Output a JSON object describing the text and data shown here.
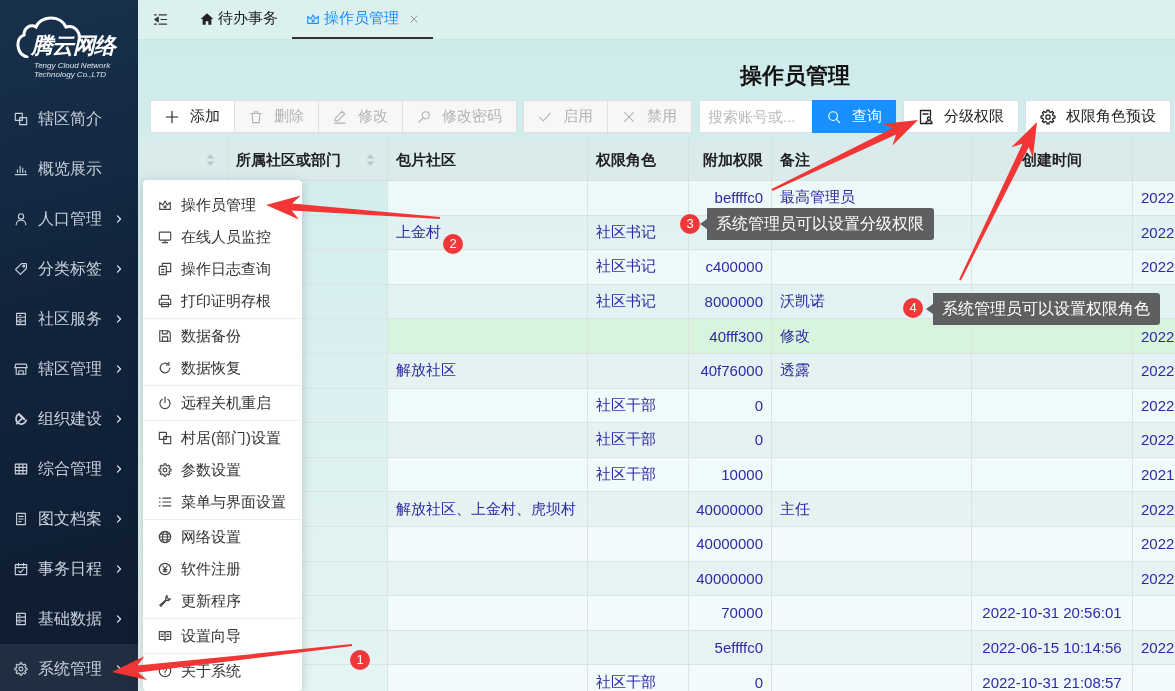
{
  "sidebar": {
    "logo": {
      "name": "腾云网络",
      "tagline": "Tengy Cloud Network Technology Co.,LTD"
    },
    "items": [
      {
        "label": "辖区简介",
        "expandable": false,
        "selected": false
      },
      {
        "label": "概览展示",
        "expandable": false,
        "selected": false
      },
      {
        "label": "人口管理",
        "expandable": true,
        "selected": false
      },
      {
        "label": "分类标签",
        "expandable": true,
        "selected": false
      },
      {
        "label": "社区服务",
        "expandable": true,
        "selected": false
      },
      {
        "label": "辖区管理",
        "expandable": true,
        "selected": false
      },
      {
        "label": "组织建设",
        "expandable": true,
        "selected": false
      },
      {
        "label": "综合管理",
        "expandable": true,
        "selected": false
      },
      {
        "label": "图文档案",
        "expandable": true,
        "selected": false
      },
      {
        "label": "事务日程",
        "expandable": true,
        "selected": false
      },
      {
        "label": "基础数据",
        "expandable": true,
        "selected": false
      },
      {
        "label": "系统管理",
        "expandable": true,
        "selected": true
      }
    ]
  },
  "tabs": [
    {
      "label": "待办事务",
      "selected": false,
      "closable": false
    },
    {
      "label": "操作员管理",
      "selected": true,
      "closable": true
    }
  ],
  "page_title": "操作员管理",
  "toolbar": {
    "edit_buttons": [
      {
        "label": "添加",
        "disabled": false
      },
      {
        "label": "删除",
        "disabled": true
      },
      {
        "label": "修改",
        "disabled": true
      },
      {
        "label": "修改密码",
        "disabled": true
      }
    ],
    "status_buttons": [
      {
        "label": "启用",
        "disabled": true
      },
      {
        "label": "禁用",
        "disabled": true
      }
    ],
    "search": {
      "placeholder": "搜索账号或...",
      "button": "查询"
    },
    "permission_buttons": [
      {
        "label": "分级权限"
      },
      {
        "label": "权限角色预设"
      }
    ]
  },
  "table": {
    "columns": [
      {
        "sortable": true
      },
      {
        "label": "所属社区或部门",
        "sortable": true
      },
      {
        "label": "包片社区",
        "sortable": false
      },
      {
        "label": "权限角色",
        "sortable": false
      },
      {
        "label": "附加权限",
        "sortable": false
      },
      {
        "label": "备注",
        "sortable": false
      },
      {
        "label": "创建时间",
        "sortable": false
      },
      {
        "sortable": false
      }
    ],
    "rows": [
      {
        "extra": "beffffc0",
        "note": "最高管理员",
        "column_8": "2022",
        "selected": false
      },
      {
        "area": "上金村",
        "role": "社区书记",
        "column_8": "2022",
        "selected": false
      },
      {
        "role": "社区书记",
        "extra": "c400000",
        "column_8": "2022",
        "selected": false
      },
      {
        "role": "社区书记",
        "extra": "8000000",
        "note": "沃凯诺",
        "selected": false
      },
      {
        "extra": "40fff300",
        "note": "修改",
        "column_8": "2022",
        "selected": true
      },
      {
        "area": "解放社区",
        "extra": "40f76000",
        "note": "透露",
        "column_8": "2022",
        "selected": false
      },
      {
        "role": "社区干部",
        "extra": "0",
        "column_8": "2022",
        "selected": false
      },
      {
        "role": "社区干部",
        "extra": "0",
        "column_8": "2022",
        "selected": false
      },
      {
        "role": "社区干部",
        "extra": "10000",
        "column_8": "2021",
        "selected": false
      },
      {
        "area": "解放社区、上金村、虎坝村",
        "extra": "40000000",
        "note": "主任",
        "column_8": "2022",
        "selected": false
      },
      {
        "extra": "40000000",
        "column_8": "2022",
        "selected": false
      },
      {
        "extra": "40000000",
        "column_8": "2022",
        "selected": false
      },
      {
        "extra": "70000",
        "created": "2022-10-31 20:56:01",
        "selected": false
      },
      {
        "extra": "5effffc0",
        "created": "2022-06-15 10:14:56",
        "column_8": "2022",
        "selected": false
      },
      {
        "role": "社区干部",
        "extra": "0",
        "created": "2022-10-31 21:08:57",
        "selected": false
      }
    ]
  },
  "system_menu": {
    "groups": [
      [
        "操作员管理",
        "在线人员监控",
        "操作日志查询",
        "打印证明存根"
      ],
      [
        "数据备份",
        "数据恢复"
      ],
      [
        "远程关机重启"
      ],
      [
        "村居(部门)设置",
        "参数设置",
        "菜单与界面设置"
      ],
      [
        "网络设置",
        "软件注册",
        "更新程序"
      ],
      [
        "设置向导"
      ],
      [
        "关于系统"
      ]
    ]
  },
  "annotations": [
    {
      "number": "1"
    },
    {
      "number": "2"
    },
    {
      "number": "3",
      "tooltip": "系统管理员可以设置分级权限"
    },
    {
      "number": "4",
      "tooltip": "系统管理员可以设置权限角色"
    }
  ]
}
